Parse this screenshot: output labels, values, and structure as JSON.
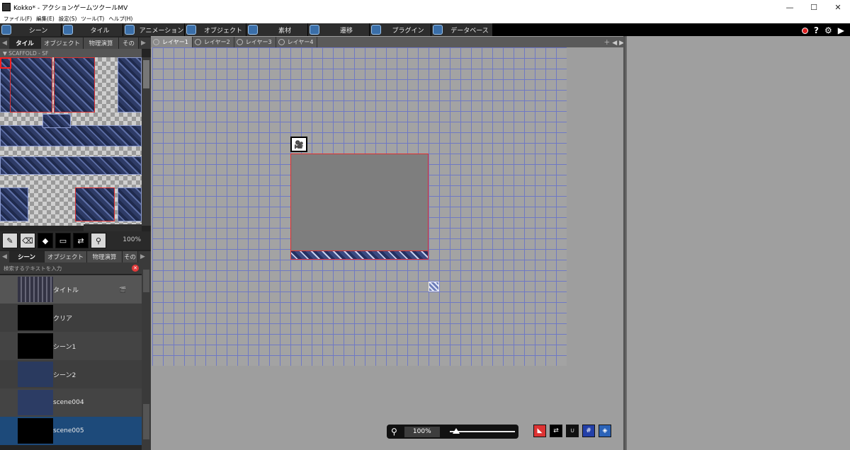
{
  "window": {
    "title": "Kokko* - アクションゲームツクールMV",
    "controls": [
      "—",
      "☐",
      "✕"
    ]
  },
  "menu": [
    "ファイル(F)",
    "編集(E)",
    "設定(S)",
    "ツール(T)",
    "ヘルプ(H)"
  ],
  "main_tabs": [
    {
      "label": "シーン",
      "icon": "scene-icon"
    },
    {
      "label": "タイル",
      "icon": "tile-icon"
    },
    {
      "label": "アニメーション",
      "icon": "animation-icon"
    },
    {
      "label": "オブジェクト",
      "icon": "object-icon"
    },
    {
      "label": "素材",
      "icon": "material-icon"
    },
    {
      "label": "遷移",
      "icon": "transition-icon"
    },
    {
      "label": "プラグイン",
      "icon": "plugin-icon"
    },
    {
      "label": "データベース",
      "icon": "database-icon"
    }
  ],
  "top_right": {
    "help": "?",
    "settings": "⚙",
    "panel_toggle": "▶"
  },
  "palette_tabs": [
    "タイル",
    "オブジェクト",
    "物理演算",
    "その"
  ],
  "tileset": {
    "name": "SCAFFOLD - SF"
  },
  "tools": [
    "eraser-pencil",
    "eraser",
    "fill",
    "rect-select",
    "layer-tool",
    "zoom"
  ],
  "palette_zoom": "100%",
  "scene_tabs": [
    "シーン",
    "オブジェクト",
    "物理演算",
    "その"
  ],
  "search": {
    "placeholder": "検索するテキストを入力"
  },
  "scenes": [
    {
      "name": "タイトル"
    },
    {
      "name": "クリア"
    },
    {
      "name": "シーン1"
    },
    {
      "name": "シーン2"
    },
    {
      "name": "scene004"
    },
    {
      "name": "scene005",
      "selected": true
    }
  ],
  "layers": [
    "レイヤー1",
    "レイヤー2",
    "レイヤー3",
    "レイヤー4"
  ],
  "zoom": {
    "value": "100%",
    "slider_fraction": 0.1
  },
  "colors": {
    "accent_blue": "#3a6ea8",
    "grid_line": "#6f79c4",
    "selection_red": "#e03030",
    "selected_row": "#1d4a7a"
  }
}
